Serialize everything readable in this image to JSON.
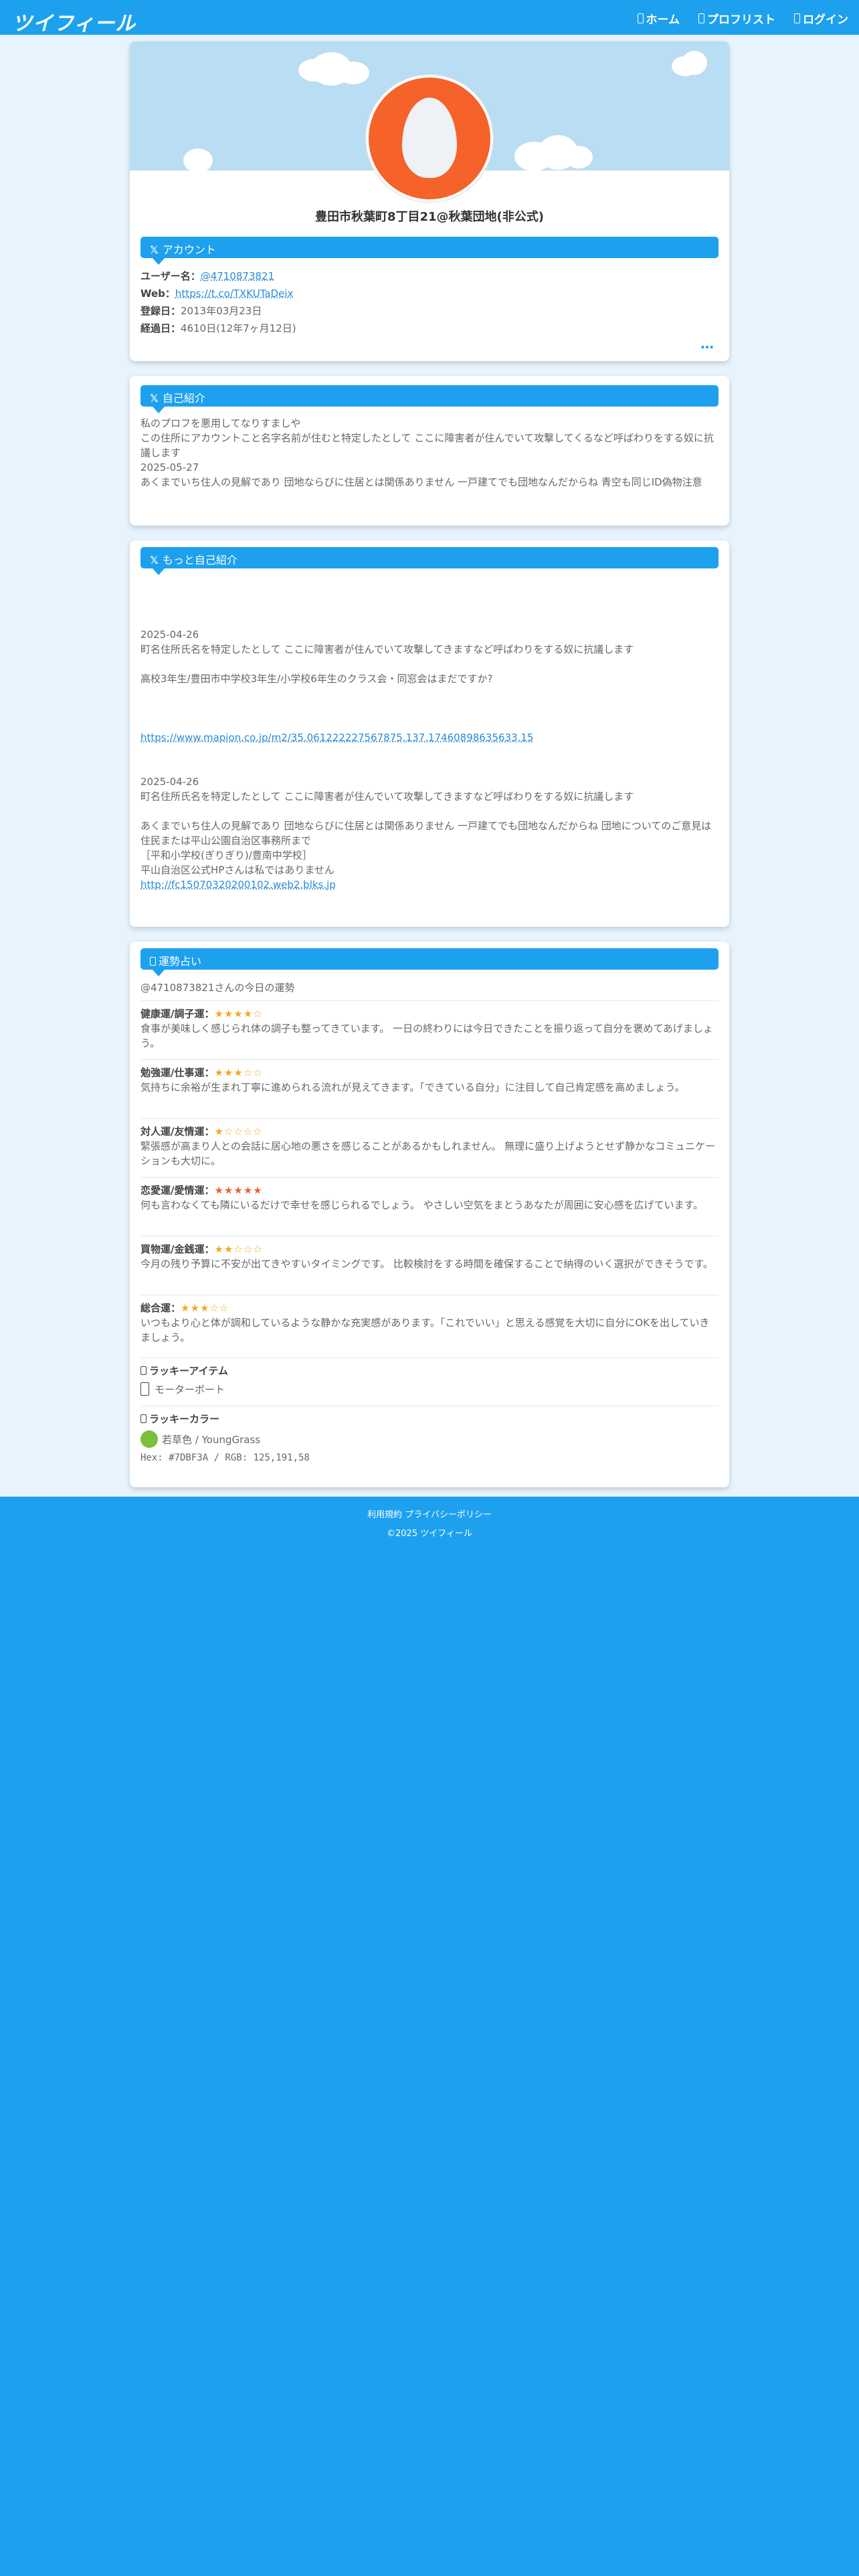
{
  "header": {
    "logo": "ツイフィール",
    "nav": [
      "ホーム",
      "プロフリスト",
      "ログイン"
    ]
  },
  "profile": {
    "display_name": "豊田市秋葉町8丁目21@秋葉団地(非公式)",
    "account_section_title": "アカウント",
    "username_label": "ユーザー名：",
    "username": "@4710873821",
    "web_label": "Web：",
    "web": "https://t.co/TXKUTaDeix",
    "registered_label": "登録日：",
    "registered": "2013年03月23日",
    "elapsed_label": "経過日：",
    "elapsed": "4610日(12年7ヶ月12日)",
    "more": "…"
  },
  "intro": {
    "title": "自己紹介",
    "lines": [
      "私のプロフを悪用してなりすましや",
      "この住所にアカウントこと名字名前が住むと特定したとして ここに障害者が住んでいて攻撃してくるなど呼ばわりをする奴に抗議します",
      "2025-05-27",
      "あくまでいち住人の見解であり 団地ならびに住居とは関係ありません 一戸建てでも団地なんだからね 青空も同じID偽物注意"
    ]
  },
  "more_intro": {
    "title": "もっと自己紹介",
    "date1": "2025-04-26",
    "line1": "町名住所氏名を特定したとして ここに障害者が住んでいて攻撃してきますなど呼ばわりをする奴に抗議します",
    "line2": "高校3年生/豊田市中学校3年生/小学校6年生のクラス会・同窓会はまだですか?",
    "map_link": "https://www.mapion.co.jp/m2/35.061222227567875,137.17460898635633,15",
    "date2": "2025-04-26",
    "line3": "町名住所氏名を特定したとして ここに障害者が住んでいて攻撃してきますなど呼ばわりをする奴に抗議します",
    "line4": "あくまでいち住人の見解であり 団地ならびに住居とは関係ありません 一戸建てでも団地なんだからね 団地についてのご意見は住民または平山公園自治区事務所まで",
    "line5": "［平和小学校(ぎりぎり)/豊南中学校］",
    "line6": "平山自治区公式HPさんは私ではありません",
    "link2": "http://fc15070320200102.web2.blks.jp"
  },
  "fortune": {
    "title": "運勢占い",
    "subtitle": "@4710873821さんの今日の運勢",
    "items": [
      {
        "label": "健康運/調子運：",
        "stars": "★★★★☆",
        "text": "食事が美味しく感じられ体の調子も整ってきています。 一日の終わりには今日できたことを振り返って自分を褒めてあげましょう。"
      },
      {
        "label": "勉強運/仕事運：",
        "stars": "★★★☆☆",
        "text": "気持ちに余裕が生まれ丁寧に進められる流れが見えてきます。「できている自分」に注目して自己肯定感を高めましょう。"
      },
      {
        "label": "対人運/友情運：",
        "stars": "★☆☆☆☆",
        "text": "緊張感が高まり人との会話に居心地の悪さを感じることがあるかもしれません。 無理に盛り上げようとせず静かなコミュニケーションも大切に。"
      },
      {
        "label": "恋愛運/愛情運：",
        "stars": "★★★★★",
        "text": "何も言わなくても隣にいるだけで幸せを感じられるでしょう。 やさしい空気をまとうあなたが周囲に安心感を広げています。"
      },
      {
        "label": "買物運/金銭運：",
        "stars": "★★☆☆☆",
        "text": "今月の残り予算に不安が出てきやすいタイミングです。 比較検討をする時間を確保することで納得のいく選択ができそうです。"
      },
      {
        "label": "総合運：",
        "stars": "★★★☆☆",
        "text": "いつもより心と体が調和しているような静かな充実感があります。「これでいい」と思える感覚を大切に自分にOKを出していきましょう。"
      }
    ],
    "lucky_item_title": "ラッキーアイテム",
    "lucky_item": "モーターボート",
    "lucky_color_title": "ラッキーカラー",
    "lucky_color_name": "若草色 / YoungGrass",
    "lucky_color_code": "Hex: #7DBF3A / RGB: 125,191,58",
    "lucky_color_hex": "#7DBF3A"
  },
  "footer": {
    "terms": "利用規約",
    "privacy": "プライバシーポリシー",
    "copyright": "©2025 ツイフィール"
  }
}
